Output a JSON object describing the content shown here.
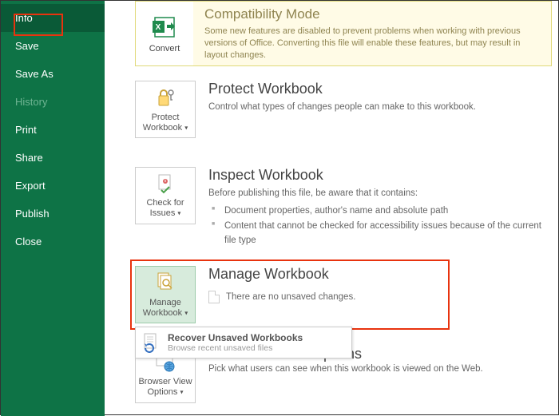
{
  "sidebar": {
    "items": [
      {
        "label": "Info",
        "selected": true
      },
      {
        "label": "Save"
      },
      {
        "label": "Save As"
      },
      {
        "label": "History",
        "disabled": true
      },
      {
        "label": "Print"
      },
      {
        "label": "Share"
      },
      {
        "label": "Export"
      },
      {
        "label": "Publish"
      },
      {
        "label": "Close"
      }
    ]
  },
  "compat": {
    "convert_label": "Convert",
    "title": "Compatibility Mode",
    "text": "Some new features are disabled to prevent problems when working with previous versions of Office. Converting this file will enable these features, but may result in layout changes."
  },
  "protect": {
    "card_label": "Protect Workbook",
    "title": "Protect Workbook",
    "desc": "Control what types of changes people can make to this workbook."
  },
  "inspect": {
    "card_label": "Check for Issues",
    "title": "Inspect Workbook",
    "desc": "Before publishing this file, be aware that it contains:",
    "items": [
      "Document properties, author's name and absolute path",
      "Content that cannot be checked for accessibility issues because of the current file type"
    ]
  },
  "manage": {
    "card_label": "Manage Workbook",
    "title": "Manage Workbook",
    "no_unsaved": "There are no unsaved changes."
  },
  "popup": {
    "title": "Recover Unsaved Workbooks",
    "sub": "Browse recent unsaved files"
  },
  "browser": {
    "card_label": "Browser View Options",
    "title_fragment": "Options",
    "desc": "Pick what users can see when this workbook is viewed on the Web."
  }
}
